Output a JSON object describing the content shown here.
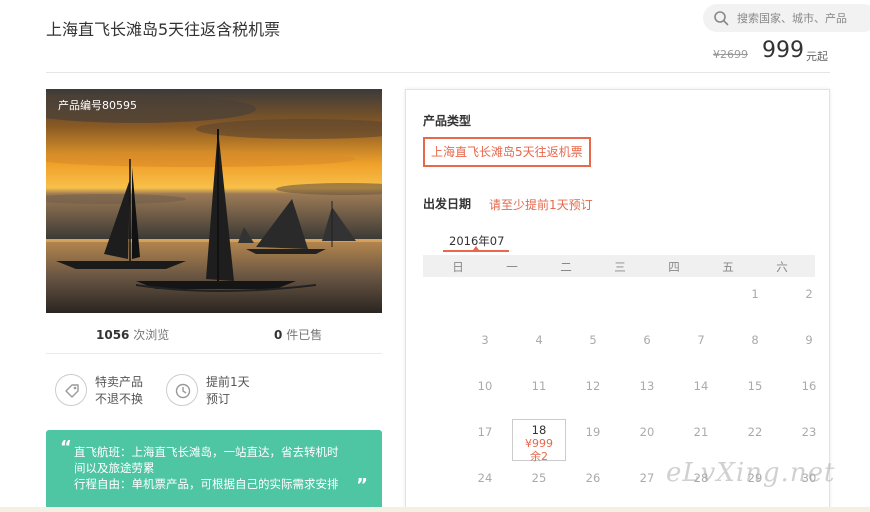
{
  "product": {
    "title": "上海直飞长滩岛5天往返含税机票",
    "number_label": "产品编号80595",
    "original_price": "¥2699",
    "price": "999",
    "price_suffix": "元起"
  },
  "search": {
    "placeholder": "搜索国家、城市、产品",
    "icon": "search-icon"
  },
  "stats": {
    "views_count": "1056",
    "views_label": "次浏览",
    "sold_count": "0",
    "sold_label": "件已售"
  },
  "features": [
    {
      "icon": "tag-icon",
      "line1": "特卖产品",
      "line2": "不退不换"
    },
    {
      "icon": "clock-icon",
      "line1": "提前1天",
      "line2": "预订"
    }
  ],
  "quote": {
    "open": "“",
    "close": "”",
    "line1": "直飞航班：上海直飞长滩岛，一站直达，省去转机时",
    "line2": "间以及旅途劳累",
    "line3": "行程自由：单机票产品，可根据自己的实际需求安排"
  },
  "booking": {
    "type_label": "产品类型",
    "type_option": "上海直飞长滩岛5天往返机票",
    "date_label": "出发日期",
    "date_hint": "请至少提前1天预订",
    "month": "2016年07",
    "weekdays": [
      "日",
      "一",
      "二",
      "三",
      "四",
      "五",
      "六"
    ],
    "days": [
      "1",
      "2",
      "3",
      "4",
      "5",
      "6",
      "7",
      "8",
      "9",
      "10",
      "11",
      "12",
      "13",
      "14",
      "15",
      "16",
      "17",
      "18",
      "19",
      "20",
      "21",
      "22",
      "23",
      "24",
      "25",
      "26",
      "27",
      "28",
      "29",
      "30"
    ],
    "selected": {
      "day": "18",
      "price": "¥999",
      "stock": "余2"
    }
  },
  "watermark": "eLvXing.net",
  "colors": {
    "accent": "#e7684b",
    "quote_bg": "#4ec5a3"
  }
}
